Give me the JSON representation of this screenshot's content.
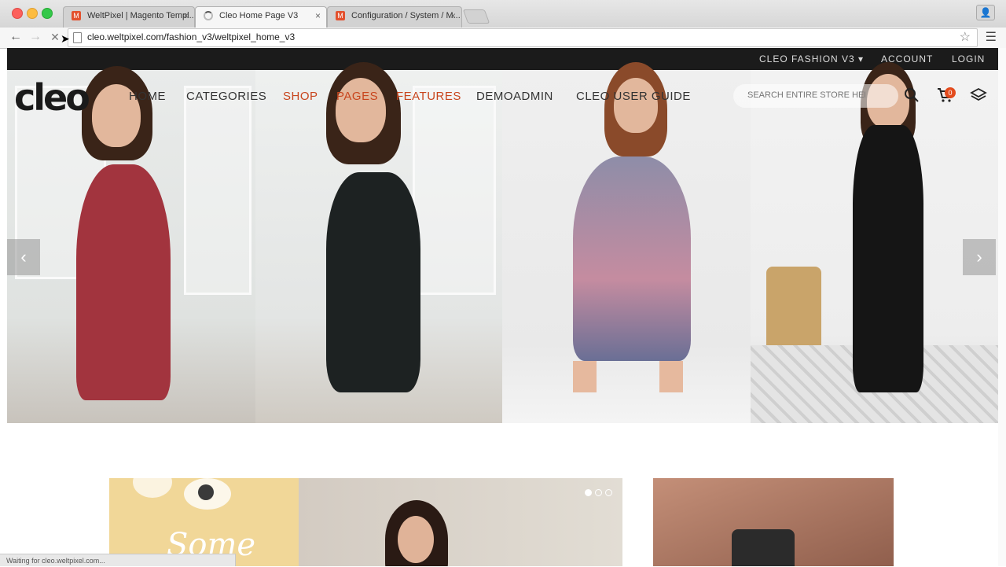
{
  "browser": {
    "tabs": [
      {
        "title": "WeltPixel | Magento Templ..."
      },
      {
        "title": "Cleo Home Page V3"
      },
      {
        "title": "Configuration / System / M..."
      }
    ],
    "url": "cleo.weltpixel.com/fashion_v3/weltpixel_home_v3",
    "status": "Waiting for cleo.weltpixel.com..."
  },
  "topbar": {
    "store": "CLEO FASHION V3 ▾",
    "account": "ACCOUNT",
    "login": "LOGIN"
  },
  "header": {
    "logo": "cleo",
    "nav": [
      "HOME",
      "CATEGORIES",
      "SHOP",
      "PAGES",
      "FEATURES",
      "DEMOADMIN",
      "CLEO USER GUIDE"
    ],
    "search_placeholder": "SEARCH ENTIRE STORE HERE...",
    "cart_count": "0"
  },
  "banner": {
    "script_text": "Some"
  },
  "colors": {
    "accent": "#c8451d",
    "topbar": "#1b1b1b",
    "cart_badge": "#e34b1d"
  }
}
